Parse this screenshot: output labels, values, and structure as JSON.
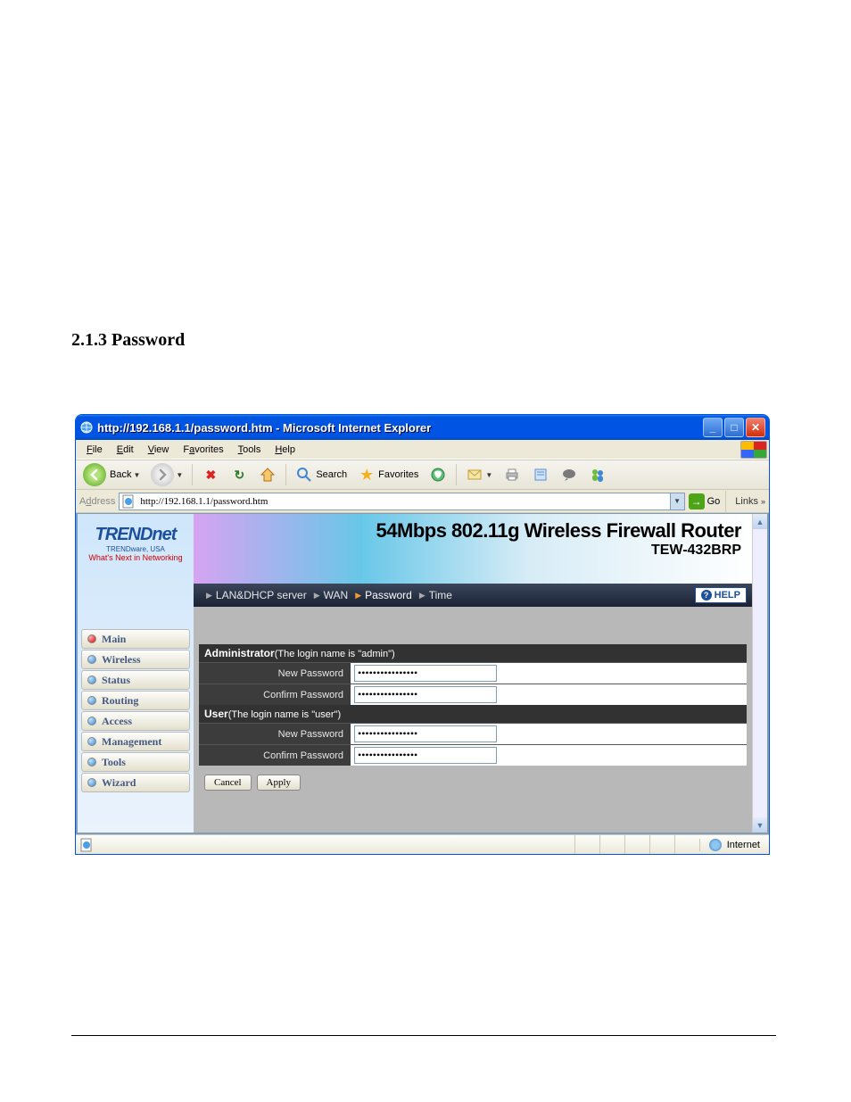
{
  "page_heading": "2.1.3  Password",
  "window": {
    "title": "http://192.168.1.1/password.htm - Microsoft Internet Explorer"
  },
  "menubar": {
    "file": "File",
    "edit": "Edit",
    "view": "View",
    "favorites": "Favorites",
    "tools": "Tools",
    "help": "Help"
  },
  "toolbar": {
    "back": "Back",
    "search": "Search",
    "favorites": "Favorites"
  },
  "address": {
    "label": "Address",
    "value": "http://192.168.1.1/password.htm",
    "go": "Go",
    "links": "Links"
  },
  "brand": {
    "name": "TRENDnet",
    "sub1": "TRENDware, USA",
    "sub2": "What's Next in Networking"
  },
  "sidebar": {
    "items": [
      {
        "label": "Main",
        "active": true
      },
      {
        "label": "Wireless",
        "active": false
      },
      {
        "label": "Status",
        "active": false
      },
      {
        "label": "Routing",
        "active": false
      },
      {
        "label": "Access",
        "active": false
      },
      {
        "label": "Management",
        "active": false
      },
      {
        "label": "Tools",
        "active": false
      },
      {
        "label": "Wizard",
        "active": false
      }
    ]
  },
  "banner": {
    "title": "54Mbps 802.11g Wireless Firewall Router",
    "model": "TEW-432BRP"
  },
  "subnav": {
    "items": [
      "LAN&DHCP server",
      "WAN",
      "Password",
      "Time"
    ],
    "active": "Password",
    "help": "HELP"
  },
  "form": {
    "admin": {
      "header_title": "Administrator",
      "header_note": "(The login name is \"admin\")",
      "new_password_label": "New Password",
      "new_password_value": "••••••••••••••••",
      "confirm_password_label": "Confirm Password",
      "confirm_password_value": "••••••••••••••••"
    },
    "user": {
      "header_title": "User",
      "header_note": "(The login name is \"user\")",
      "new_password_label": "New Password",
      "new_password_value": "••••••••••••••••",
      "confirm_password_label": "Confirm Password",
      "confirm_password_value": "••••••••••••••••"
    },
    "cancel": "Cancel",
    "apply": "Apply"
  },
  "status": {
    "zone": "Internet"
  }
}
